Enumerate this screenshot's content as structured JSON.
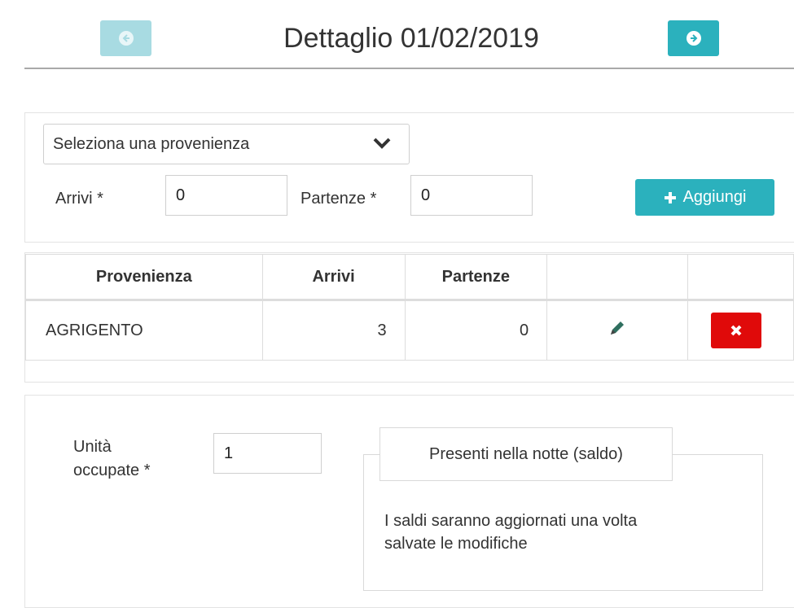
{
  "header": {
    "title": "Dettaglio 01/02/2019",
    "prev_icon": "arrow-circle-left-icon",
    "next_icon": "arrow-circle-right-icon"
  },
  "form": {
    "select_placeholder": "Seleziona una provenienza",
    "arrivi_label": "Arrivi *",
    "arrivi_value": "0",
    "partenze_label": "Partenze *",
    "partenze_value": "0",
    "add_button_label": "Aggiungi"
  },
  "table": {
    "columns": [
      "Provenienza",
      "Arrivi",
      "Partenze",
      "",
      ""
    ],
    "rows": [
      {
        "provenienza": "AGRIGENTO",
        "arrivi": "3",
        "partenze": "0"
      }
    ]
  },
  "bottom": {
    "unita_label_line1": "Unità",
    "unita_label_line2": "occupate *",
    "unita_value": "1",
    "legend": "Presenti nella notte (saldo)",
    "note_line1": "I saldi saranno aggiornati una volta",
    "note_line2": "salvate le modifiche"
  },
  "colors": {
    "accent": "#2bb1bd",
    "accent_disabled": "#a8dbe2",
    "danger": "#e00a0a",
    "edit_icon": "#2f6f5f"
  }
}
